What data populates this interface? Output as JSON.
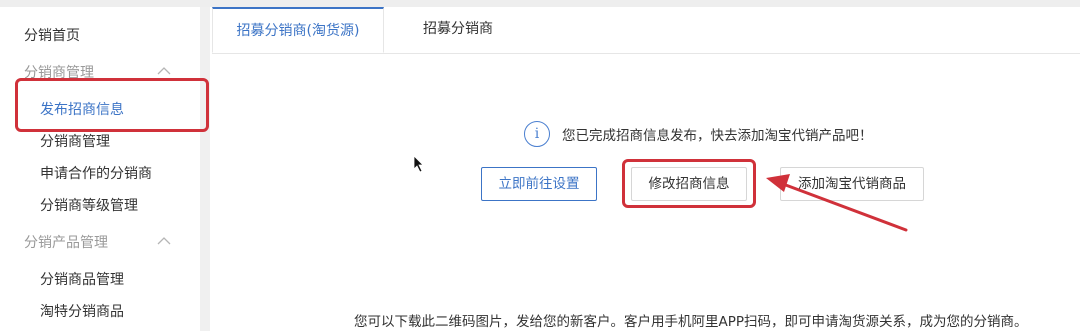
{
  "sidebar": {
    "home": "分销首页",
    "group_distributor": "分销商管理",
    "items_distributor": [
      "发布招商信息",
      "分销商管理",
      "申请合作的分销商",
      "分销商等级管理"
    ],
    "group_product": "分销产品管理",
    "items_product": [
      "分销商品管理",
      "淘特分销商品"
    ]
  },
  "tabs": [
    "招募分销商(淘货源)",
    "招募分销商"
  ],
  "main": {
    "info_icon_glyph": "i",
    "info_text": "您已完成招商信息发布，快去添加淘宝代销产品吧！",
    "buttons": {
      "go_settings": "立即前往设置",
      "edit_info": "修改招商信息",
      "add_products": "添加淘宝代销商品"
    },
    "bottom_text": "您可以下载此二维码图片，发给您的新客户。客户用手机阿里APP扫码，即可申请淘货源关系，成为您的分销商。"
  },
  "colors": {
    "accent": "#3c74c6",
    "highlight": "#d0313a"
  }
}
